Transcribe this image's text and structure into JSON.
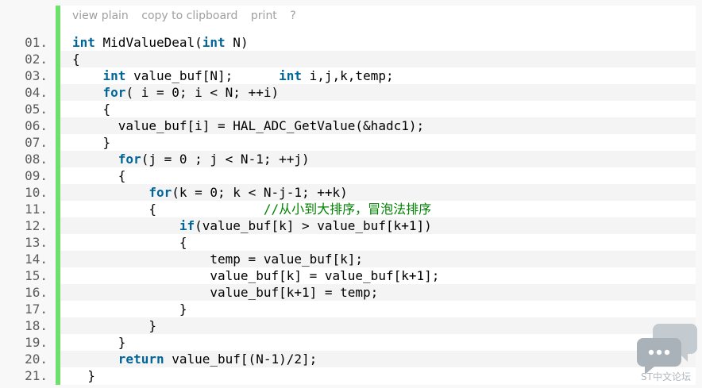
{
  "toolbar": {
    "view_plain": "view plain",
    "copy": "copy to clipboard",
    "print": "print",
    "help": "?"
  },
  "lines": [
    {
      "num": "01.",
      "tokens": [
        {
          "t": "int",
          "k": "kw"
        },
        {
          "t": " MidValueDeal("
        },
        {
          "t": "int",
          "k": "kw"
        },
        {
          "t": " N)"
        }
      ]
    },
    {
      "num": "02.",
      "tokens": [
        {
          "t": "{"
        }
      ]
    },
    {
      "num": "03.",
      "tokens": [
        {
          "t": "    "
        },
        {
          "t": "int",
          "k": "kw"
        },
        {
          "t": " value_buf[N];      "
        },
        {
          "t": "int",
          "k": "kw"
        },
        {
          "t": " i,j,k,temp;"
        }
      ]
    },
    {
      "num": "04.",
      "tokens": [
        {
          "t": "    "
        },
        {
          "t": "for",
          "k": "kw"
        },
        {
          "t": "( i = 0; i < N; ++i)"
        }
      ]
    },
    {
      "num": "05.",
      "tokens": [
        {
          "t": "    {"
        }
      ]
    },
    {
      "num": "06.",
      "tokens": [
        {
          "t": "      value_buf[i] = HAL_ADC_GetValue(&hadc1);"
        }
      ]
    },
    {
      "num": "07.",
      "tokens": [
        {
          "t": "    }"
        }
      ]
    },
    {
      "num": "08.",
      "tokens": [
        {
          "t": "      "
        },
        {
          "t": "for",
          "k": "kw"
        },
        {
          "t": "(j = 0 ; j < N-1; ++j)"
        }
      ]
    },
    {
      "num": "09.",
      "tokens": [
        {
          "t": "      {"
        }
      ]
    },
    {
      "num": "10.",
      "tokens": [
        {
          "t": "          "
        },
        {
          "t": "for",
          "k": "kw"
        },
        {
          "t": "(k = 0; k < N-j-1; ++k)"
        }
      ]
    },
    {
      "num": "11.",
      "tokens": [
        {
          "t": "          {              "
        },
        {
          "t": "//从小到大排序，冒泡法排序",
          "k": "cm"
        }
      ]
    },
    {
      "num": "12.",
      "tokens": [
        {
          "t": "              "
        },
        {
          "t": "if",
          "k": "kw"
        },
        {
          "t": "(value_buf[k] > value_buf[k+1])"
        }
      ]
    },
    {
      "num": "13.",
      "tokens": [
        {
          "t": "              {"
        }
      ]
    },
    {
      "num": "14.",
      "tokens": [
        {
          "t": "                  temp = value_buf[k];"
        }
      ]
    },
    {
      "num": "15.",
      "tokens": [
        {
          "t": "                  value_buf[k] = value_buf[k+1];"
        }
      ]
    },
    {
      "num": "16.",
      "tokens": [
        {
          "t": "                  value_buf[k+1] = temp;"
        }
      ]
    },
    {
      "num": "17.",
      "tokens": [
        {
          "t": "              }"
        }
      ]
    },
    {
      "num": "18.",
      "tokens": [
        {
          "t": "          }"
        }
      ]
    },
    {
      "num": "19.",
      "tokens": [
        {
          "t": "      }"
        }
      ]
    },
    {
      "num": "20.",
      "tokens": [
        {
          "t": "      "
        },
        {
          "t": "return",
          "k": "kw"
        },
        {
          "t": " value_buf[(N-1)/2];"
        }
      ]
    },
    {
      "num": "21.",
      "tokens": [
        {
          "t": "  }"
        }
      ]
    }
  ],
  "watermark": {
    "text": "ST中文论坛",
    "icon": "chat-bubbles-icon",
    "color": "#b0b7bd"
  },
  "colors": {
    "gutter_bar": "#6ce26c",
    "keyword": "#006699",
    "comment": "#008200",
    "line_number": "#5c5c5c"
  }
}
